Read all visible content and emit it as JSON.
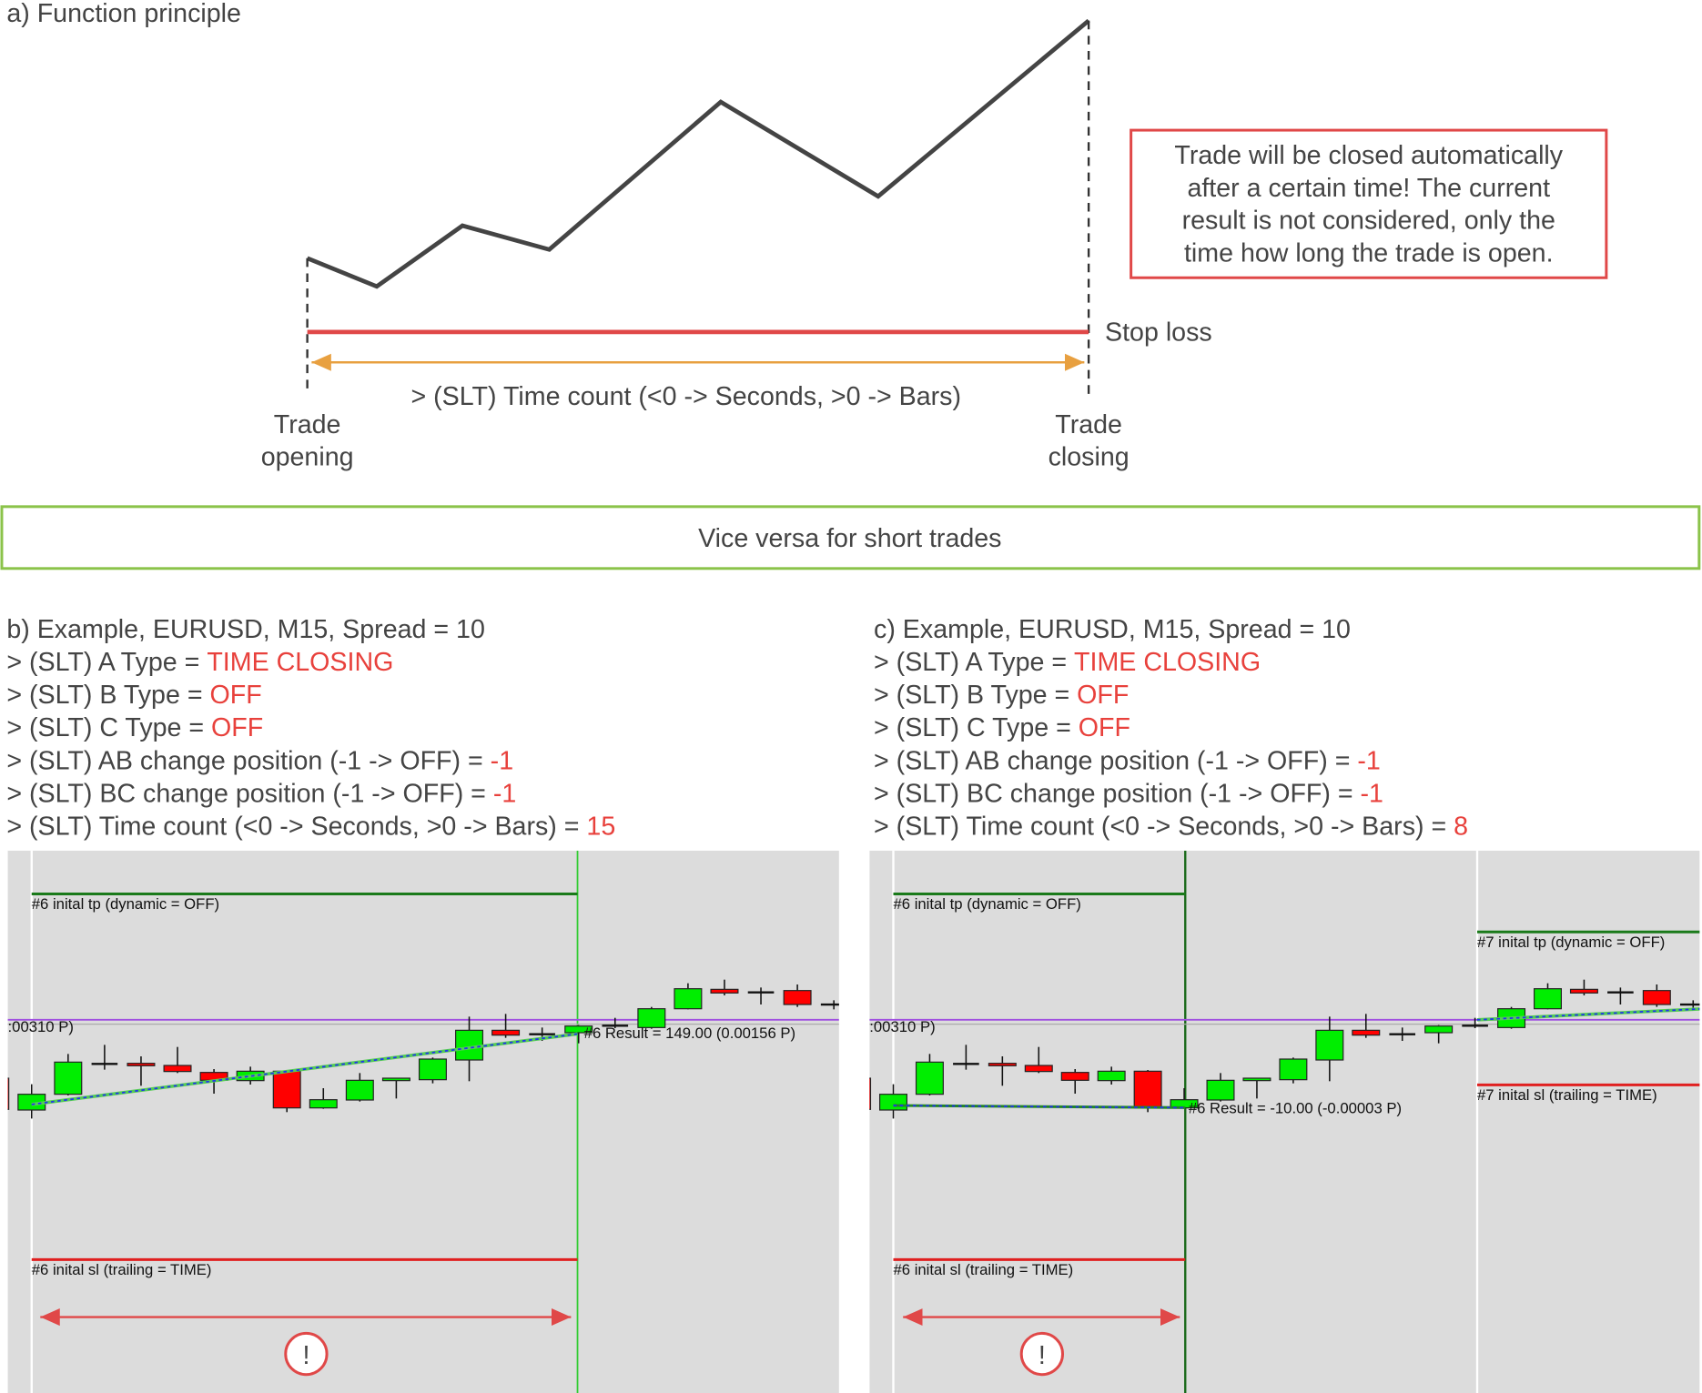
{
  "diagram": {
    "title": "a) Function principle",
    "note_lines": [
      "Trade will be closed automatically",
      "after a certain time! The current",
      "result is not considered, only the",
      "time how long the trade is open."
    ],
    "stop_loss_label": "Stop loss",
    "time_count_label": "> (SLT) Time count (<0 -> Seconds, >0 -> Bars)",
    "trade_opening": [
      "Trade",
      "opening"
    ],
    "trade_closing": [
      "Trade",
      "closing"
    ],
    "colors": {
      "price_line": "#444444",
      "stop_loss": "#e04848",
      "time_arrow": "#e8a040",
      "note_border": "#e04848"
    }
  },
  "banner": {
    "text": "Vice versa for short trades",
    "border_color": "#8bc34a"
  },
  "examples": [
    {
      "heading": "b) Example, EURUSD, M15, Spread = 10",
      "settings": [
        {
          "label": "> (SLT) A Type = ",
          "value": "TIME CLOSING"
        },
        {
          "label": "> (SLT) B Type = ",
          "value": "OFF"
        },
        {
          "label": "> (SLT) C Type = ",
          "value": "OFF"
        },
        {
          "label": "> (SLT) AB change position (-1 -> OFF) = ",
          "value": "-1"
        },
        {
          "label": "> (SLT) BC change position (-1 -> OFF) = ",
          "value": "-1"
        },
        {
          "label": "> (SLT) Time count (<0 -> Seconds, >0 -> Bars) = ",
          "value": "15"
        }
      ],
      "chart": {
        "tp_label": "#6 inital tp (dynamic = OFF)",
        "sl_label": "#6 inital sl (trailing = TIME)",
        "level_label": ":00310 P)",
        "result_label": "#6 Result = 149.00 (0.00156 P)",
        "warning_symbol": "!"
      }
    },
    {
      "heading": "c) Example, EURUSD, M15, Spread = 10",
      "settings": [
        {
          "label": "> (SLT) A Type = ",
          "value": "TIME CLOSING"
        },
        {
          "label": "> (SLT) B Type = ",
          "value": "OFF"
        },
        {
          "label": "> (SLT) C Type = ",
          "value": "OFF"
        },
        {
          "label": "> (SLT) AB change position (-1 -> OFF) = ",
          "value": "-1"
        },
        {
          "label": "> (SLT) BC change position (-1 -> OFF) = ",
          "value": "-1"
        },
        {
          "label": "> (SLT) Time count (<0 -> Seconds, >0 -> Bars) = ",
          "value": "8"
        }
      ],
      "chart": {
        "tp_label": "#6 inital tp (dynamic = OFF)",
        "sl_label": "#6 inital sl (trailing = TIME)",
        "tp7_label": "#7 inital tp (dynamic = OFF)",
        "sl7_label": "#7 inital sl (trailing = TIME)",
        "level_label": ":00310 P)",
        "result_label": "#6 Result = -10.00 (-0.00003 P)",
        "warning_symbol": "!"
      }
    }
  ],
  "candles_ohlc": [
    [
      43.5,
      43.5,
      33.2,
      33.2
    ],
    [
      33,
      41.5,
      30.2,
      38.2
    ],
    [
      38.2,
      51.5,
      37.8,
      48.8
    ],
    [
      48.2,
      54.5,
      46.3,
      48.2
    ],
    [
      48.4,
      50.7,
      41,
      47.6
    ],
    [
      47.7,
      53.8,
      45.2,
      45.7
    ],
    [
      45.4,
      46.5,
      38.4,
      42.8
    ],
    [
      42.7,
      47.3,
      41.4,
      45.8
    ],
    [
      45.8,
      46.2,
      32.3,
      33.7
    ],
    [
      33.7,
      40.2,
      33.4,
      36.4
    ],
    [
      36.3,
      45.2,
      35.8,
      42.8
    ],
    [
      42.7,
      43.5,
      36.8,
      43.5
    ],
    [
      43,
      50.3,
      41.8,
      49.8
    ],
    [
      49.5,
      63.8,
      42.5,
      59.3
    ],
    [
      59.3,
      64.7,
      56.8,
      57.7
    ],
    [
      58,
      60.2,
      55.8,
      58
    ],
    [
      58.5,
      61,
      55,
      60.7
    ],
    [
      60.8,
      63.4,
      60,
      60.8
    ],
    [
      60.2,
      67,
      59.8,
      66.4
    ],
    [
      66.4,
      74.8,
      66.2,
      73
    ],
    [
      72.8,
      76,
      70.8,
      71.6
    ],
    [
      71.8,
      73.4,
      67.8,
      71.8
    ],
    [
      72.4,
      74.4,
      67,
      67.8
    ],
    [
      67.8,
      69.2,
      66.2,
      67.8
    ]
  ],
  "colors": {
    "bull": "#00ee00",
    "bear": "#ff0000",
    "chart_bg": "#dcdcdc",
    "accent_red": "#e8413c",
    "tp_line": "#1a7a1a",
    "level_line": "#a050e0"
  }
}
